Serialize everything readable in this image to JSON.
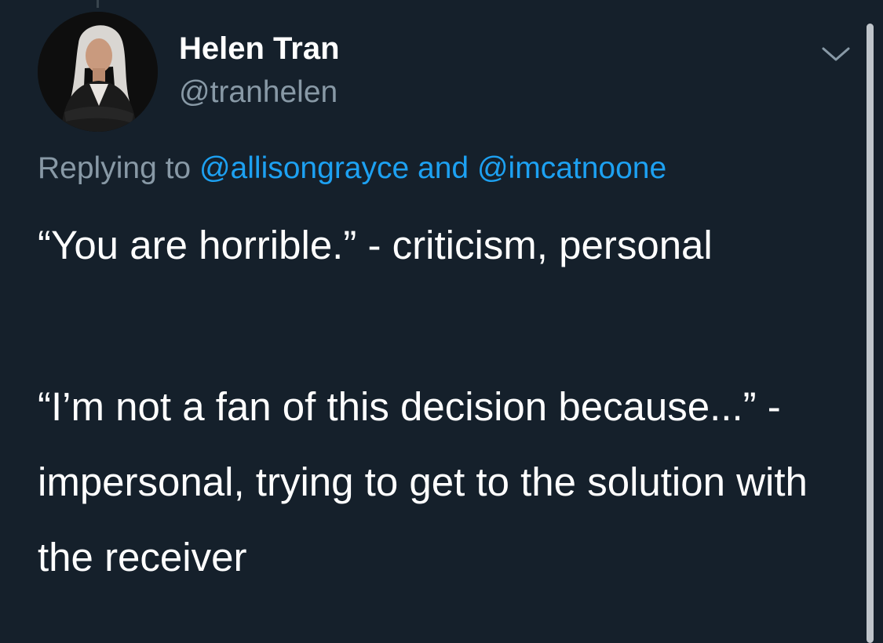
{
  "tweet": {
    "author_name": "Helen Tran",
    "author_handle": "@tranhelen",
    "replying_prefix": "Replying to",
    "reply_mentions": [
      "@allisongrayce",
      "@imcatnoone"
    ],
    "reply_conjunction": "and",
    "paragraphs": [
      "“You are horrible.” - criticism, personal",
      "“I’m not a fan of this decision because...” - impersonal, trying to get to the solution with the receiver"
    ]
  },
  "icons": {
    "menu": "chevron-down-icon"
  },
  "colors": {
    "background": "#15202b",
    "text": "#ffffff",
    "secondary_text": "#8899a6",
    "link": "#1da1f2"
  }
}
